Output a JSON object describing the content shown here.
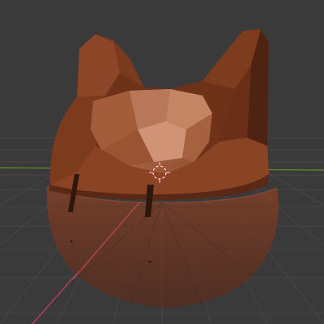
{
  "viewport": {
    "background": "#3a3a3a",
    "grid_color": "#454545",
    "grid_subtle_color": "#414141",
    "x_axis_color": "#c2465a",
    "y_axis_color": "#6a9a2a"
  },
  "model": {
    "color_dark": "#4e2312",
    "color_mid": "#7a3a1d",
    "color_light": "#a8613e",
    "color_highlight": "#c98a6c",
    "ghost_color": "#7a3a22",
    "ghost_opacity": 0.55
  },
  "origin_marker": {
    "icon": "3d-cursor-icon",
    "ring_color": "#ffffff",
    "accent_color": "#e04040"
  }
}
